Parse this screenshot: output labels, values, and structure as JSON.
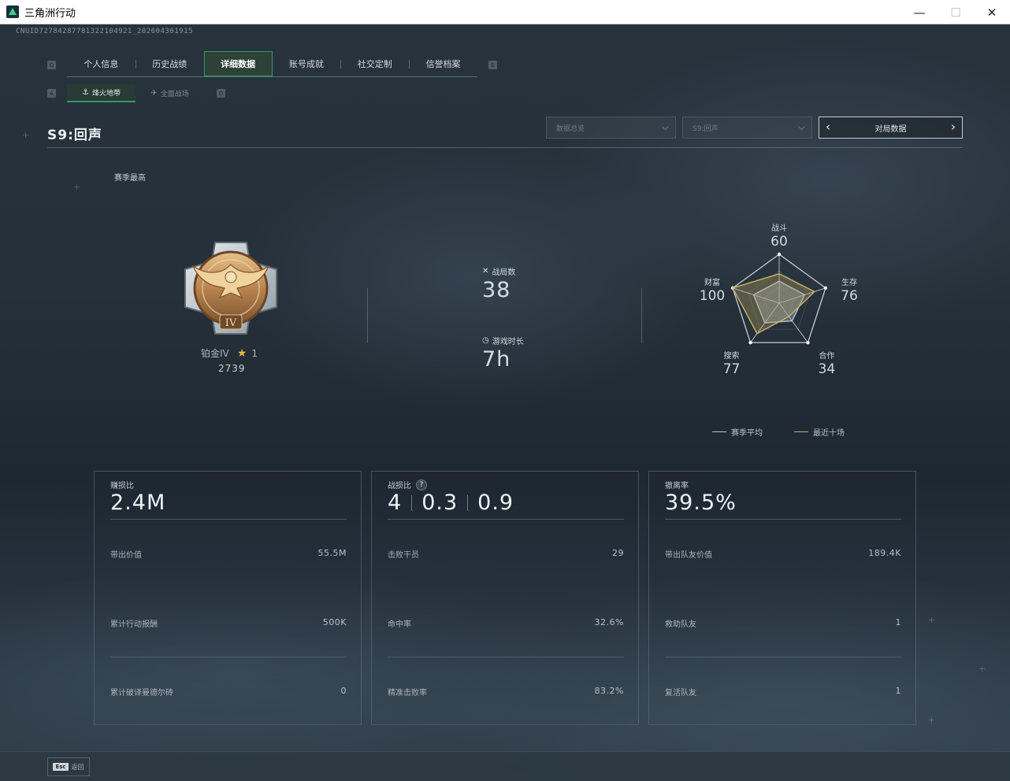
{
  "window": {
    "title": "三角洲行动",
    "minimize": "—",
    "maximize": "☐",
    "close": "✕"
  },
  "cnuid": "CNUID72784287781322104921_202604301915",
  "ghost_title": "",
  "tabs": {
    "left_key": "Q",
    "right_key": "E",
    "items": [
      {
        "label": "个人信息",
        "active": false
      },
      {
        "label": "历史战绩",
        "active": false
      },
      {
        "label": "详细数据",
        "active": true
      },
      {
        "label": "账号成就",
        "active": false
      },
      {
        "label": "社交定制",
        "active": false
      },
      {
        "label": "信誉档案",
        "active": false
      }
    ]
  },
  "subtabs": {
    "left_key": "A",
    "right_key": "D",
    "items": [
      {
        "label": "烽火地带",
        "icon": "flame-zone-icon",
        "active": true
      },
      {
        "label": "全面战场",
        "icon": "battlefield-icon",
        "active": false
      }
    ]
  },
  "season": {
    "title": "S9:回声",
    "dropdown_mode": "数据总览",
    "dropdown_season": "S9:回声",
    "pager_label": "对局数据"
  },
  "rank": {
    "season_best_label": "赛季最高",
    "tier": "铂金IV",
    "stars": "1",
    "score": "2739",
    "badge_numeral": "IV"
  },
  "matches": {
    "games_label": "战局数",
    "games_value": "38",
    "playtime_label": "游戏时长",
    "playtime_value": "7h"
  },
  "radar": {
    "axes": [
      {
        "label": "战斗",
        "value": "60"
      },
      {
        "label": "生存",
        "value": "76"
      },
      {
        "label": "合作",
        "value": "34"
      },
      {
        "label": "搜索",
        "value": "77"
      },
      {
        "label": "财富",
        "value": "100"
      }
    ],
    "season_avg": [
      0.45,
      0.55,
      0.45,
      0.5,
      0.55
    ],
    "recent_ten": [
      0.6,
      0.76,
      0.34,
      0.77,
      1.0
    ],
    "legend_avg": "赛季平均",
    "legend_recent": "最近十场",
    "colors": {
      "avg": "#b8c3cc",
      "recent": "#c9b36a"
    }
  },
  "cards": [
    {
      "label": "赚损比",
      "value": "2.4M",
      "rows": [
        {
          "label": "带出价值",
          "value": "55.5M"
        },
        {
          "label": "累计行动报酬",
          "value": "500K"
        },
        {
          "label": "累计破译曼德尔砖",
          "value": "0"
        }
      ]
    },
    {
      "label": "战损比",
      "help": "?",
      "values": [
        "4",
        "0.3",
        "0.9"
      ],
      "rows": [
        {
          "label": "击败干员",
          "value": "29"
        },
        {
          "label": "命中率",
          "value": "32.6%"
        },
        {
          "label": "精准击败率",
          "value": "83.2%"
        }
      ]
    },
    {
      "label": "撤离率",
      "value": "39.5%",
      "rows": [
        {
          "label": "带出队友价值",
          "value": "189.4K"
        },
        {
          "label": "救助队友",
          "value": "1"
        },
        {
          "label": "复活队友",
          "value": "1"
        }
      ]
    }
  ],
  "footer": {
    "esc_key": "Esc",
    "back_label": "返回"
  },
  "colors": {
    "accent": "#2f9b66",
    "background": "#1b2530",
    "star": "#e3b843"
  }
}
